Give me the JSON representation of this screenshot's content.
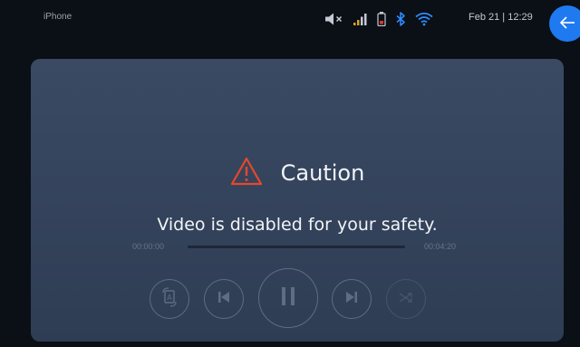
{
  "status_bar": {
    "device_name": "iPhone",
    "datetime": "Feb 21 | 12:29",
    "icons": [
      "mute-icon",
      "signal-icon",
      "battery-icon",
      "bluetooth-icon",
      "wifi-icon"
    ],
    "accent_color": "#1f7af0"
  },
  "alert": {
    "icon": "warning-triangle-icon",
    "icon_color": "#e8472c",
    "title": "Caution",
    "message": "Video is disabled for your safety."
  },
  "playback": {
    "elapsed": "00:00:00",
    "total": "00:04:20",
    "progress_fraction": 0
  },
  "controls": [
    {
      "name": "subtitle-language-button",
      "icon": "language-icon"
    },
    {
      "name": "previous-button",
      "icon": "skip-previous-icon"
    },
    {
      "name": "pause-button",
      "icon": "pause-icon"
    },
    {
      "name": "next-button",
      "icon": "skip-next-icon"
    },
    {
      "name": "shuffle-button",
      "icon": "shuffle-icon"
    }
  ]
}
